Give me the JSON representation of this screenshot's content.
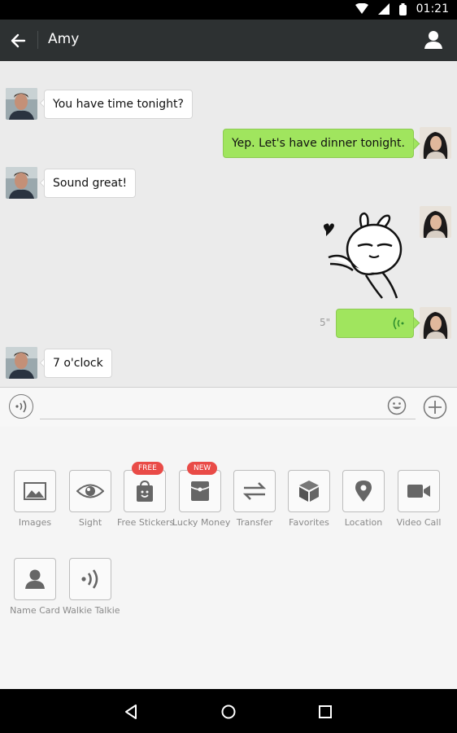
{
  "status_bar": {
    "time": "01:21"
  },
  "header": {
    "title": "Amy"
  },
  "messages": [
    {
      "side": "left",
      "text": "You have time tonight?"
    },
    {
      "side": "right",
      "text": "Yep. Let's have dinner tonight."
    },
    {
      "side": "left",
      "text": "Sound great!"
    },
    {
      "side": "right",
      "type": "sticker"
    },
    {
      "side": "right",
      "type": "voice",
      "duration": "5\""
    },
    {
      "side": "left",
      "text": "7 o'clock"
    }
  ],
  "input": {
    "value": "",
    "placeholder": ""
  },
  "tools": [
    {
      "label": "Images",
      "icon": "image-icon"
    },
    {
      "label": "Sight",
      "icon": "eye-icon"
    },
    {
      "label": "Free Stickers",
      "icon": "sticker-bag-icon",
      "tag": "FREE"
    },
    {
      "label": "Lucky Money",
      "icon": "red-packet-icon",
      "tag": "NEW"
    },
    {
      "label": "Transfer",
      "icon": "transfer-icon"
    },
    {
      "label": "Favorites",
      "icon": "cube-icon"
    },
    {
      "label": "Location",
      "icon": "location-pin-icon"
    },
    {
      "label": "Video Call",
      "icon": "video-camera-icon"
    },
    {
      "label": "Name Card",
      "icon": "person-icon"
    },
    {
      "label": "Walkie Talkie",
      "icon": "walkie-talkie-icon"
    }
  ],
  "colors": {
    "header_bg": "#2d3132",
    "sent_bubble": "#a0e55e",
    "tag_red": "#e94b47"
  }
}
